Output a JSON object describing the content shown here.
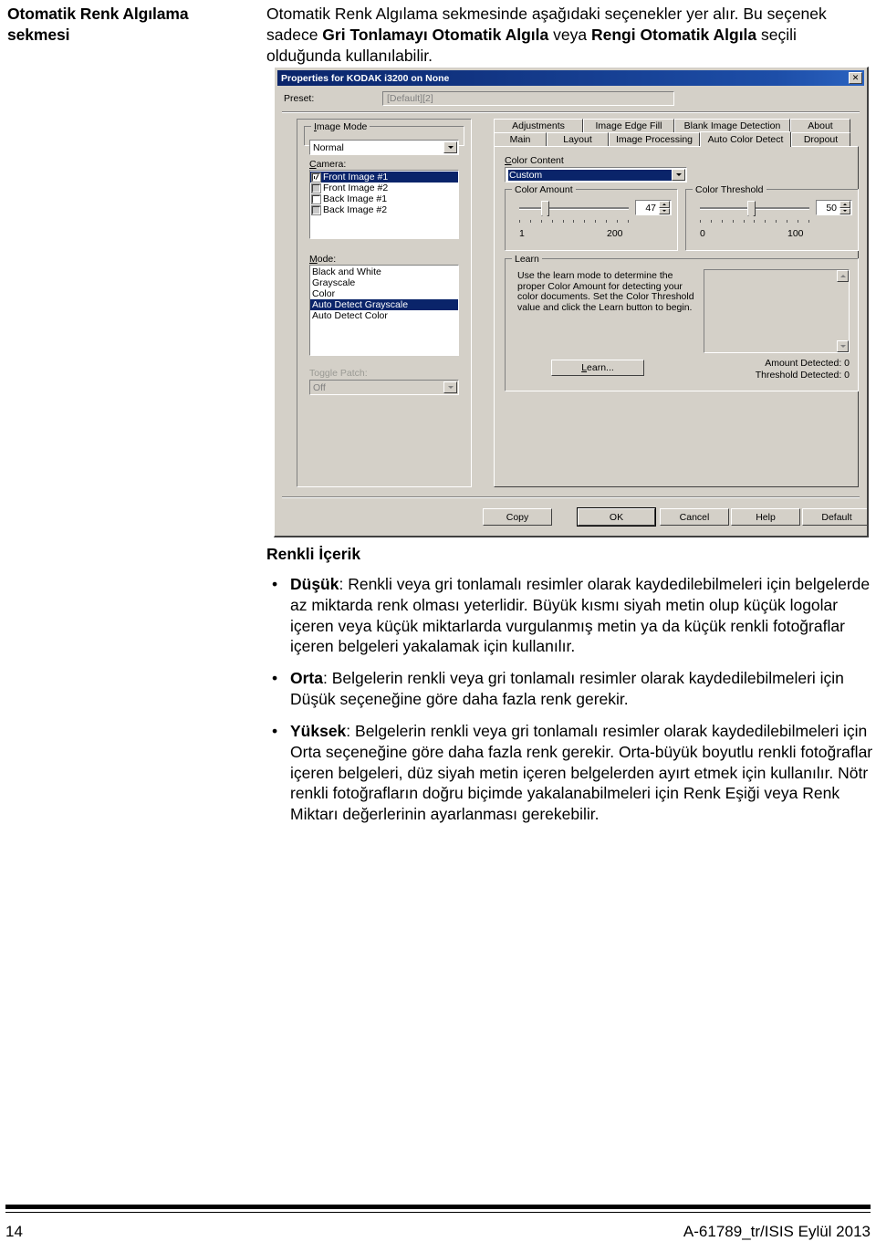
{
  "left_column": {
    "heading": "Otomatik Renk Algılama sekmesi"
  },
  "intro": {
    "line1_a": "Otomatik Renk Algılama sekmesinde aşağıdaki seçenekler yer alır. Bu seçenek sadece ",
    "bold1": "Gri Tonlamayı Otomatik Algıla",
    "line1_b": " veya ",
    "bold2": "Rengi Otomatik Algıla",
    "line1_c": " seçili olduğunda kullanılabilir."
  },
  "dialog": {
    "title": "Properties for KODAK i3200 on None",
    "close_label": "✕",
    "preset": {
      "label": "Preset:",
      "value": "[Default][2]"
    },
    "image_mode": {
      "group_title": "Image Mode",
      "combo_value": "Normal"
    },
    "camera": {
      "label": "Camera:",
      "items": [
        {
          "label": "Front Image #1",
          "checked": true,
          "selected": true,
          "disabled": false
        },
        {
          "label": "Front Image #2",
          "checked": false,
          "selected": false,
          "disabled": true
        },
        {
          "label": "Back Image #1",
          "checked": false,
          "selected": false,
          "disabled": false
        },
        {
          "label": "Back Image #2",
          "checked": false,
          "selected": false,
          "disabled": true
        }
      ]
    },
    "mode": {
      "label": "Mode:",
      "items": [
        {
          "label": "Black and White",
          "selected": false
        },
        {
          "label": "Grayscale",
          "selected": false
        },
        {
          "label": "Color",
          "selected": false
        },
        {
          "label": "Auto Detect Grayscale",
          "selected": true
        },
        {
          "label": "Auto Detect Color",
          "selected": false
        }
      ]
    },
    "toggle_patch": {
      "label": "Toggle Patch:",
      "value": "Off"
    },
    "tabs_row1": [
      {
        "label": "Adjustments",
        "active": false
      },
      {
        "label": "Image Edge Fill",
        "active": false
      },
      {
        "label": "Blank Image Detection",
        "active": false
      },
      {
        "label": "About",
        "active": false
      }
    ],
    "tabs_row2": [
      {
        "label": "Main",
        "active": false
      },
      {
        "label": "Layout",
        "active": false
      },
      {
        "label": "Image Processing",
        "active": false
      },
      {
        "label": "Auto Color Detect",
        "active": true
      },
      {
        "label": "Dropout",
        "active": false
      }
    ],
    "color_content": {
      "label": "Color Content",
      "value": "Custom"
    },
    "color_amount": {
      "group_title": "Color Amount",
      "value": "47",
      "min_label": "1",
      "max_label": "200",
      "thumb_percent": 23
    },
    "color_threshold": {
      "group_title": "Color Threshold",
      "value": "50",
      "min_label": "0",
      "max_label": "100",
      "thumb_percent": 50
    },
    "learn": {
      "group_title": "Learn",
      "description": "Use the learn mode to determine the proper Color Amount for detecting your color documents. Set the Color Threshold value and click the Learn button to begin.",
      "button_label": "Learn...",
      "amount_detected": "Amount Detected:  0",
      "threshold_detected": "Threshold Detected:  0"
    },
    "buttons": [
      {
        "label": "Copy",
        "default": false
      },
      {
        "label": "OK",
        "default": true
      },
      {
        "label": "Cancel",
        "default": false
      },
      {
        "label": "Help",
        "default": false
      },
      {
        "label": "Default",
        "default": false
      }
    ]
  },
  "body": {
    "section_title": "Renkli İçerik",
    "bullet_char": "•",
    "bullets": [
      {
        "bold": "Düşük",
        "text": ": Renkli veya gri tonlamalı resimler olarak kaydedilebilmeleri için belgelerde az miktarda renk olması yeterlidir. Büyük kısmı siyah metin olup küçük logolar içeren veya küçük miktarlarda vurgulanmış metin ya da küçük renkli fotoğraflar içeren belgeleri yakalamak için kullanılır."
      },
      {
        "bold": "Orta",
        "text": ": Belgelerin renkli veya gri tonlamalı resimler olarak kaydedilebilmeleri için Düşük seçeneğine göre daha fazla renk gerekir."
      },
      {
        "bold": "Yüksek",
        "text": ": Belgelerin renkli veya gri tonlamalı resimler olarak kaydedilebilmeleri için Orta seçeneğine göre daha fazla renk gerekir. Orta-büyük boyutlu renkli fotoğraflar içeren belgeleri, düz siyah metin içeren belgelerden ayırt etmek için kullanılır. Nötr renkli fotoğrafların doğru biçimde yakalanabilmeleri için Renk Eşiği veya Renk Miktarı değerlerinin ayarlanması gerekebilir."
      }
    ]
  },
  "footer": {
    "page_number": "14",
    "doc_ref": "A-61789_tr/ISIS  Eylül 2013"
  },
  "colors": {
    "dialog_face": "#d4d0c8",
    "titlebar": "#0a246a",
    "selection": "#0a246a"
  }
}
